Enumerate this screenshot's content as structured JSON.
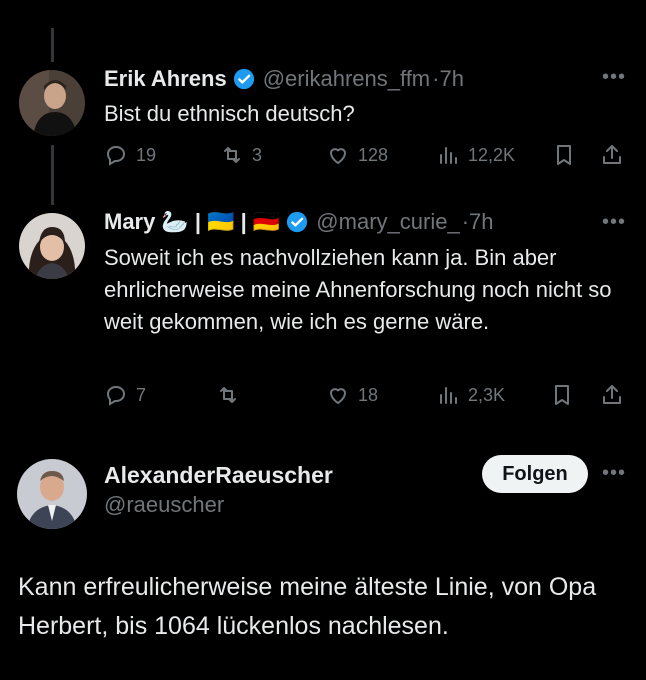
{
  "tweets": [
    {
      "name": "Erik Ahrens",
      "handle": "@erikahrens_ffm",
      "time": "·7h",
      "text": "Bist du ethnisch deutsch?",
      "stats": {
        "replies": "19",
        "retweets": "3",
        "likes": "128",
        "views": "12,2K"
      }
    },
    {
      "name": "Mary",
      "name_extras": "🦢 | 🇺🇦 | 🇩🇪",
      "handle": "@mary_curie_",
      "time": "·7h",
      "text": "Soweit ich es nachvollziehen kann ja. Bin aber ehrlicherweise meine Ahnenforschung noch nicht so weit gekommen, wie ich es gerne wäre.",
      "stats": {
        "replies": "7",
        "retweets": "",
        "likes": "18",
        "views": "2,3K"
      }
    }
  ],
  "main_tweet": {
    "name": "AlexanderRaeuscher",
    "handle": "@raeuscher",
    "follow_label": "Folgen",
    "text": "Kann erfreulicherweise meine älteste Linie, von Opa Herbert, bis 1064 lückenlos nachlesen."
  },
  "colors": {
    "background": "#000000",
    "text": "#e7e9ea",
    "muted": "#71767b",
    "verified": "#1d9bf0",
    "follow_bg": "#eff3f4"
  },
  "icons": [
    "reply-icon",
    "retweet-icon",
    "like-icon",
    "views-icon",
    "bookmark-icon",
    "share-icon",
    "verified-badge-icon",
    "more-icon"
  ]
}
